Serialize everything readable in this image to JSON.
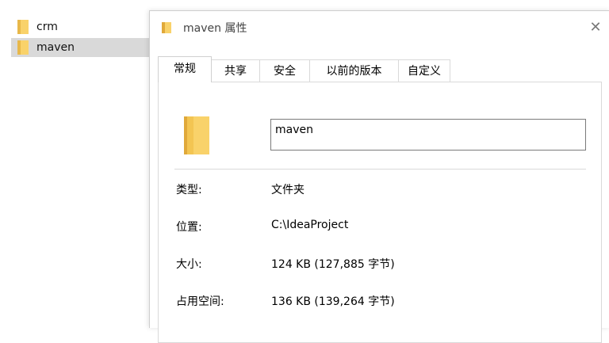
{
  "explorer": {
    "items": [
      {
        "label": "crm",
        "selected": false,
        "icon": "folder-icon"
      },
      {
        "label": "maven",
        "selected": true,
        "icon": "folder-icon"
      }
    ]
  },
  "dialog": {
    "title": "maven 属性",
    "close_glyph": "✕",
    "tabs": [
      {
        "label": "常规",
        "active": true
      },
      {
        "label": "共享",
        "active": false
      },
      {
        "label": "安全",
        "active": false
      },
      {
        "label": "以前的版本",
        "active": false
      },
      {
        "label": "自定义",
        "active": false
      }
    ],
    "folder_name": "maven",
    "properties": [
      {
        "label": "类型:",
        "value": "文件夹"
      },
      {
        "label": "位置:",
        "value": "C:\\IdeaProject"
      },
      {
        "label": "大小:",
        "value": "124 KB (127,885 字节)"
      },
      {
        "label": "占用空间:",
        "value": "136 KB (139,264 字节)"
      }
    ]
  },
  "colors": {
    "folder_yellow": "#f9d26a",
    "selection_bg": "#d9d9d9"
  }
}
